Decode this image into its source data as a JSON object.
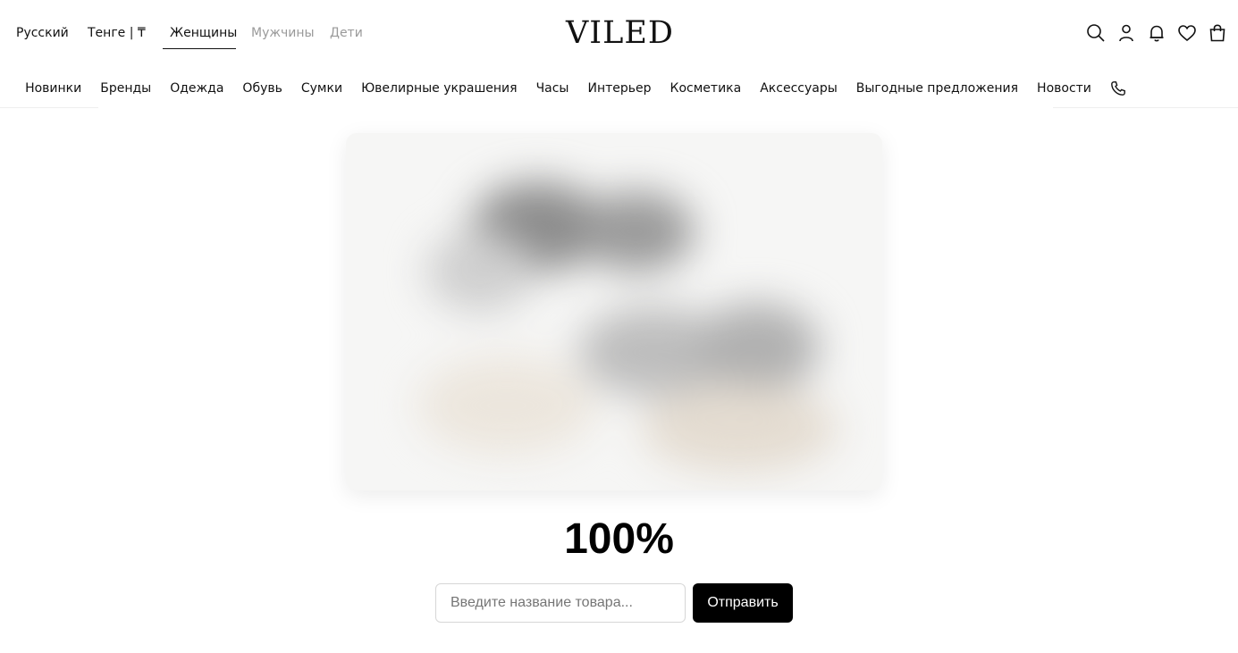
{
  "header": {
    "language": "Русский",
    "currency": "Тенге | ₸",
    "genders": [
      {
        "label": "Женщины",
        "active": true
      },
      {
        "label": "Мужчины",
        "active": false
      },
      {
        "label": "Дети",
        "active": false
      }
    ],
    "logo": "VILED",
    "icons": [
      "search-icon",
      "user-icon",
      "bell-icon",
      "heart-icon",
      "bag-icon"
    ]
  },
  "nav": {
    "items": [
      "Новинки",
      "Бренды",
      "Одежда",
      "Обувь",
      "Сумки",
      "Ювелирные украшения",
      "Часы",
      "Интерьер",
      "Косметика",
      "Аксессуары",
      "Выгодные предложения",
      "Новости"
    ],
    "phone_icon": "phone-icon"
  },
  "main": {
    "progress_text": "100%",
    "search": {
      "placeholder": "Введите название товара...",
      "value": ""
    },
    "submit_label": "Отправить"
  },
  "colors": {
    "text": "#111111",
    "muted": "#9a9a9a",
    "button_bg": "#000000",
    "button_text": "#ffffff"
  }
}
